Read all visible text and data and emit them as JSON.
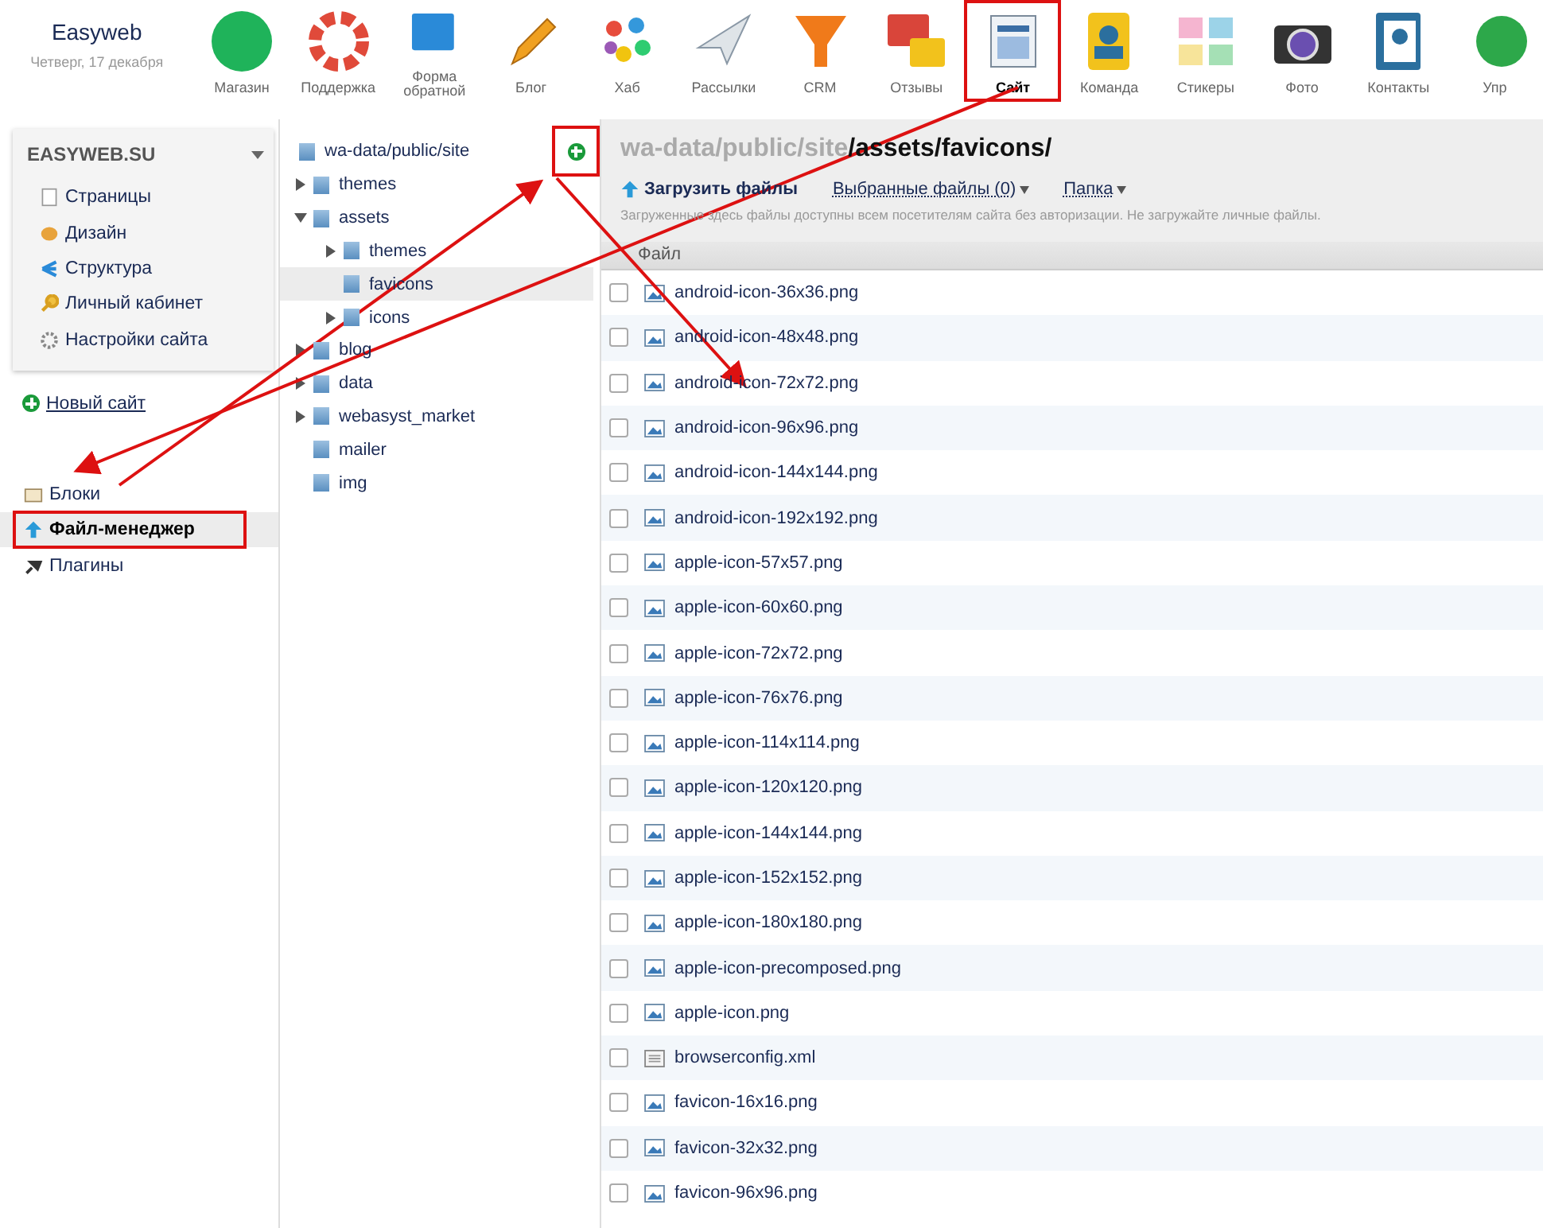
{
  "header": {
    "title": "Easyweb",
    "date": "Четверг, 17 декабря"
  },
  "apps": [
    {
      "label": "Магазин",
      "selected": false,
      "highlighted": false
    },
    {
      "label": "Поддержка",
      "selected": false,
      "highlighted": false
    },
    {
      "label": "Форма обратной",
      "selected": false,
      "highlighted": false
    },
    {
      "label": "Блог",
      "selected": false,
      "highlighted": false
    },
    {
      "label": "Хаб",
      "selected": false,
      "highlighted": false
    },
    {
      "label": "Рассылки",
      "selected": false,
      "highlighted": false
    },
    {
      "label": "CRM",
      "selected": false,
      "highlighted": false
    },
    {
      "label": "Отзывы",
      "selected": false,
      "highlighted": false
    },
    {
      "label": "Сайт",
      "selected": true,
      "highlighted": true
    },
    {
      "label": "Команда",
      "selected": false,
      "highlighted": false
    },
    {
      "label": "Стикеры",
      "selected": false,
      "highlighted": false
    },
    {
      "label": "Фото",
      "selected": false,
      "highlighted": false
    },
    {
      "label": "Контакты",
      "selected": false,
      "highlighted": false
    },
    {
      "label": "Упр",
      "selected": false,
      "highlighted": false
    }
  ],
  "site_panel": {
    "title": "EASYWEB.SU",
    "items": [
      "Страницы",
      "Дизайн",
      "Структура",
      "Личный кабинет",
      "Настройки сайта"
    ]
  },
  "new_site": "Новый сайт",
  "sections": [
    {
      "label": "Блоки",
      "selected": false,
      "highlighted": false
    },
    {
      "label": "Файл-менеджер",
      "selected": true,
      "highlighted": true
    },
    {
      "label": "Плагины",
      "selected": false,
      "highlighted": false
    }
  ],
  "tree": {
    "root": "wa-data/public/site",
    "add_highlighted": true,
    "children": [
      {
        "label": "themes",
        "kind": "branch",
        "expanded": false,
        "selected": false
      },
      {
        "label": "assets",
        "kind": "branch",
        "expanded": true,
        "selected": false,
        "children": [
          {
            "label": "themes",
            "kind": "branch",
            "expanded": false,
            "selected": false
          },
          {
            "label": "favicons",
            "kind": "leaf",
            "selected": true
          },
          {
            "label": "icons",
            "kind": "branch",
            "expanded": false,
            "selected": false
          }
        ]
      },
      {
        "label": "blog",
        "kind": "branch",
        "expanded": false,
        "selected": false
      },
      {
        "label": "data",
        "kind": "branch",
        "expanded": false,
        "selected": false
      },
      {
        "label": "webasyst_market",
        "kind": "branch",
        "expanded": false,
        "selected": false
      },
      {
        "label": "mailer",
        "kind": "leaf",
        "selected": false
      },
      {
        "label": "img",
        "kind": "leaf",
        "selected": false
      }
    ]
  },
  "path": {
    "base": "wa-data/public/site",
    "current": "/assets/favicons/"
  },
  "toolbar": {
    "upload": "Загрузить файлы",
    "selected_files": "Выбранные файлы (0)",
    "folder": "Папка"
  },
  "notice": "Загруженные здесь файлы доступны всем посетителям сайта без авторизации. Не загружайте личные файлы.",
  "table": {
    "column": "Файл",
    "files": [
      {
        "name": "android-icon-36x36.png",
        "kind": "image",
        "checked": false
      },
      {
        "name": "android-icon-48x48.png",
        "kind": "image",
        "checked": false
      },
      {
        "name": "android-icon-72x72.png",
        "kind": "image",
        "checked": false
      },
      {
        "name": "android-icon-96x96.png",
        "kind": "image",
        "checked": false
      },
      {
        "name": "android-icon-144x144.png",
        "kind": "image",
        "checked": false
      },
      {
        "name": "android-icon-192x192.png",
        "kind": "image",
        "checked": false
      },
      {
        "name": "apple-icon-57x57.png",
        "kind": "image",
        "checked": false
      },
      {
        "name": "apple-icon-60x60.png",
        "kind": "image",
        "checked": false
      },
      {
        "name": "apple-icon-72x72.png",
        "kind": "image",
        "checked": false
      },
      {
        "name": "apple-icon-76x76.png",
        "kind": "image",
        "checked": false
      },
      {
        "name": "apple-icon-114x114.png",
        "kind": "image",
        "checked": false
      },
      {
        "name": "apple-icon-120x120.png",
        "kind": "image",
        "checked": false
      },
      {
        "name": "apple-icon-144x144.png",
        "kind": "image",
        "checked": false
      },
      {
        "name": "apple-icon-152x152.png",
        "kind": "image",
        "checked": false
      },
      {
        "name": "apple-icon-180x180.png",
        "kind": "image",
        "checked": false
      },
      {
        "name": "apple-icon-precomposed.png",
        "kind": "image",
        "checked": false
      },
      {
        "name": "apple-icon.png",
        "kind": "image",
        "checked": false
      },
      {
        "name": "browserconfig.xml",
        "kind": "document",
        "checked": false
      },
      {
        "name": "favicon-16x16.png",
        "kind": "image",
        "checked": false
      },
      {
        "name": "favicon-32x32.png",
        "kind": "image",
        "checked": false
      },
      {
        "name": "favicon-96x96.png",
        "kind": "image",
        "checked": false
      }
    ]
  }
}
